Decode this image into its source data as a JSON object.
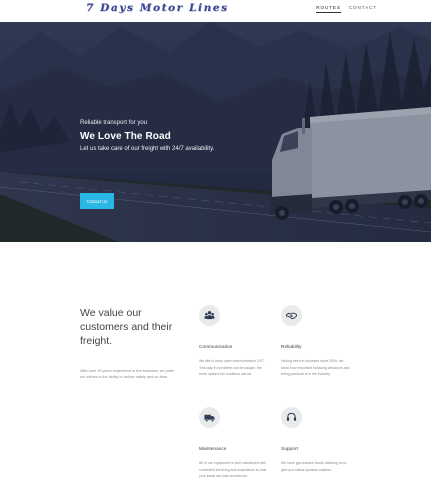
{
  "nav": {
    "logo": "7 Days Motor Lines",
    "links": [
      {
        "label": "Routes",
        "active": true
      },
      {
        "label": "Contact",
        "active": false
      }
    ]
  },
  "hero": {
    "kicker": "Reliable transport for you",
    "title": "We Love The Road",
    "subtitle": "Let us take care of our freight with 24/7 availability.",
    "button": "Contact Us"
  },
  "intro": {
    "heading": "We value our customers and their freight.",
    "body": "With over 10 years experience in the business, we pride our selves in the ability to deliver safely and on-time."
  },
  "features": [
    {
      "icon": "people-icon",
      "title": "Communication",
      "text": "We like to keep open communication 24/7. This way if a problem can be caught, the more options the solutions can be."
    },
    {
      "icon": "handshake-icon",
      "title": "Reliability",
      "text": "Having been in business since 2006, we know how important following directions and being punctual is in the industry."
    },
    {
      "icon": "truck-icon",
      "title": "Maintenance",
      "text": "All of our equipment is well maintained with consistent servicing and inspections so that your loads are safe and secure."
    },
    {
      "icon": "headset-icon",
      "title": "Support",
      "text": "We have gps tracked trucks allowing us to give you status updates anytime."
    }
  ],
  "colors": {
    "accent": "#2bb7e3",
    "logo": "#3c4590",
    "hero_overlay": "#2a3146"
  }
}
